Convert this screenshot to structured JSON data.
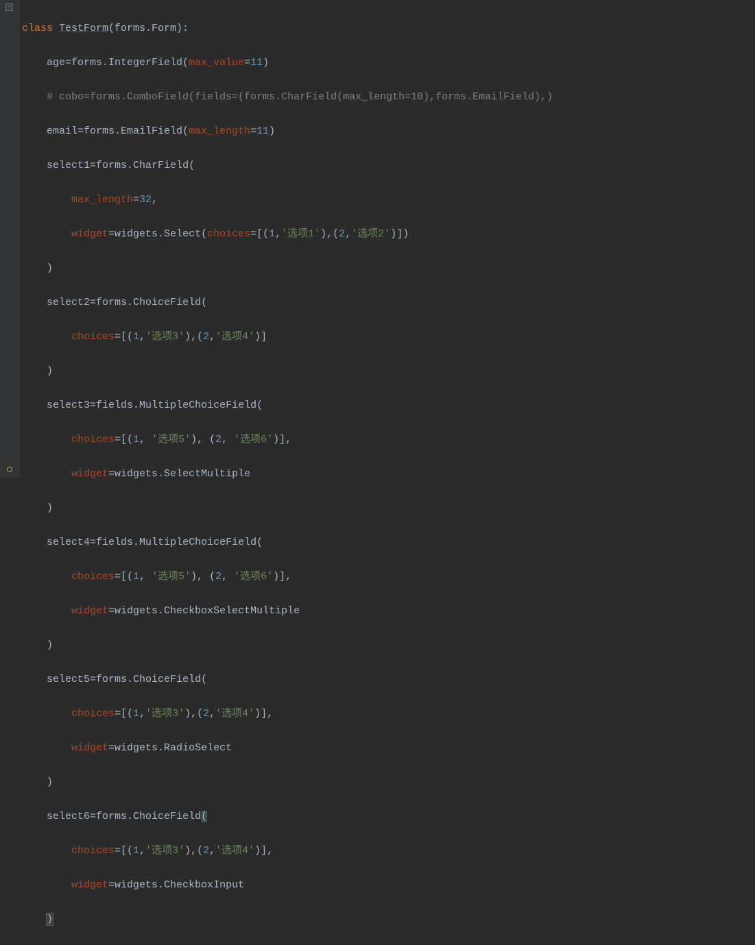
{
  "code": {
    "line1": {
      "kw": "class ",
      "cls": "TestForm",
      "paren": "(forms.Form):"
    },
    "line2": {
      "pre": "    age",
      "eq": "=",
      "call": "forms.IntegerField(",
      "param": "max_value",
      "eq2": "=",
      "num": "11",
      "close": ")"
    },
    "line3": {
      "cmt": "    # cobo=forms.ComboField(fields=(forms.CharField(max_length=10),forms.EmailField),)"
    },
    "line4": {
      "pre": "    email",
      "eq": "=",
      "call": "forms.EmailField(",
      "param": "max_length",
      "eq2": "=",
      "num": "11",
      "close": ")"
    },
    "line5": {
      "pre": "    select1",
      "eq": "=",
      "call": "forms.CharField("
    },
    "line6": {
      "indent": "        ",
      "param": "max_length",
      "eq": "=",
      "num": "32",
      "comma": ","
    },
    "line7": {
      "indent": "        ",
      "param": "widget",
      "eq": "=",
      "call": "widgets.Select(",
      "p2": "choices",
      "eq2": "=",
      "open": "[(",
      "n1": "1",
      "c1": ",",
      "s1": "'选项1'",
      "mid": "),(",
      "n2": "2",
      "c2": ",",
      "s2": "'选项2'",
      "close": ")])"
    },
    "line8": {
      "txt": "    )"
    },
    "line9": {
      "pre": "    select2",
      "eq": "=",
      "call": "forms.ChoiceField("
    },
    "line10": {
      "indent": "        ",
      "param": "choices",
      "eq": "=",
      "open": "[(",
      "n1": "1",
      "c1": ",",
      "s1": "'选项3'",
      "mid": "),(",
      "n2": "2",
      "c2": ",",
      "s2": "'选项4'",
      "close": ")]"
    },
    "line11": {
      "txt": "    )"
    },
    "line12": {
      "pre": "    select3",
      "eq": "=",
      "call": "fields.MultipleChoiceField("
    },
    "line13": {
      "indent": "        ",
      "param": "choices",
      "eq": "=",
      "open": "[(",
      "n1": "1",
      "c1": ", ",
      "s1": "'选项5'",
      "mid": "), (",
      "n2": "2",
      "c2": ", ",
      "s2": "'选项6'",
      "close": ")],"
    },
    "line14": {
      "indent": "        ",
      "param": "widget",
      "eq": "=",
      "call": "widgets.SelectMultiple"
    },
    "line15": {
      "txt": "    )"
    },
    "line16": {
      "pre": "    select4",
      "eq": "=",
      "call": "fields.MultipleChoiceField("
    },
    "line17": {
      "indent": "        ",
      "param": "choices",
      "eq": "=",
      "open": "[(",
      "n1": "1",
      "c1": ", ",
      "s1": "'选项5'",
      "mid": "), (",
      "n2": "2",
      "c2": ", ",
      "s2": "'选项6'",
      "close": ")],"
    },
    "line18": {
      "indent": "        ",
      "param": "widget",
      "eq": "=",
      "call": "widgets.CheckboxSelectMultiple"
    },
    "line19": {
      "txt": "    )"
    },
    "line20": {
      "pre": "    select5",
      "eq": "=",
      "call": "forms.ChoiceField("
    },
    "line21": {
      "indent": "        ",
      "param": "choices",
      "eq": "=",
      "open": "[(",
      "n1": "1",
      "c1": ",",
      "s1": "'选项3'",
      "mid": "),(",
      "n2": "2",
      "c2": ",",
      "s2": "'选项4'",
      "close": ")],"
    },
    "line22": {
      "indent": "        ",
      "param": "widget",
      "eq": "=",
      "call": "widgets.RadioSelect"
    },
    "line23": {
      "txt": "    )"
    },
    "line24": {
      "pre": "    select6",
      "eq": "=",
      "call": "forms.ChoiceField",
      "open": "("
    },
    "line25": {
      "indent": "        ",
      "param": "choices",
      "eq": "=",
      "open": "[(",
      "n1": "1",
      "c1": ",",
      "s1": "'选项3'",
      "mid": "),(",
      "n2": "2",
      "c2": ",",
      "s2": "'选项4'",
      "close": ")],"
    },
    "line26": {
      "indent": "        ",
      "param": "widget",
      "eq": "=",
      "call": "widgets.CheckboxInput"
    },
    "line27": {
      "close": ")"
    }
  }
}
